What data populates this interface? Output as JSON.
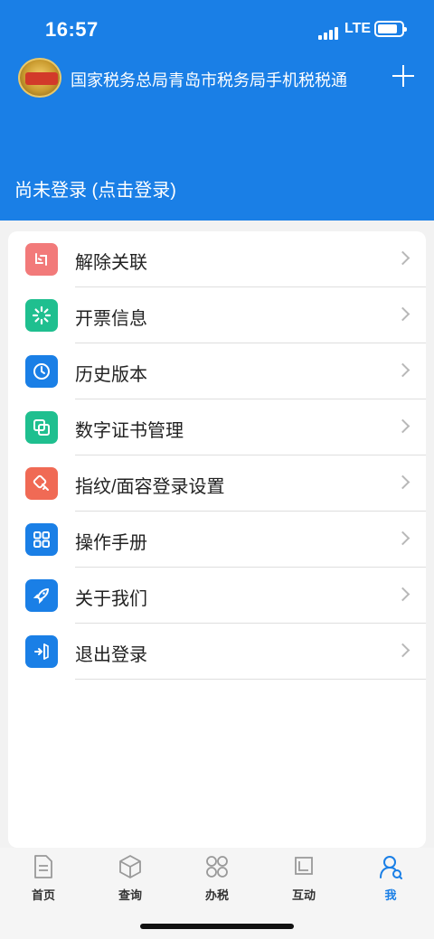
{
  "status_bar": {
    "time": "16:57",
    "network": "LTE"
  },
  "header": {
    "title": "国家税务总局青岛市税务局手机税税通",
    "login_status": "尚未登录 (点击登录)",
    "accent": "#1a7fe6"
  },
  "menu": {
    "items": [
      {
        "label": "解除关联",
        "icon": "unlink-icon",
        "color": "#f27a7a"
      },
      {
        "label": "开票信息",
        "icon": "loading-icon",
        "color": "#1fbf8f"
      },
      {
        "label": "历史版本",
        "icon": "history-clock-icon",
        "color": "#1a7fe6"
      },
      {
        "label": "数字证书管理",
        "icon": "certificate-icon",
        "color": "#1fbf8f"
      },
      {
        "label": "指纹/面容登录设置",
        "icon": "key-icon",
        "color": "#f06a55"
      },
      {
        "label": "操作手册",
        "icon": "grid-icon",
        "color": "#1a7fe6"
      },
      {
        "label": "关于我们",
        "icon": "rocket-icon",
        "color": "#1a7fe6"
      },
      {
        "label": "退出登录",
        "icon": "logout-icon",
        "color": "#1a7fe6"
      }
    ]
  },
  "tabbar": {
    "tabs": [
      {
        "label": "首页",
        "icon": "home-document-icon",
        "active": false
      },
      {
        "label": "查询",
        "icon": "cube-icon",
        "active": false
      },
      {
        "label": "办税",
        "icon": "apps-grid-icon",
        "active": false
      },
      {
        "label": "互动",
        "icon": "chat-square-icon",
        "active": false
      },
      {
        "label": "我",
        "icon": "profile-icon",
        "active": true
      }
    ]
  }
}
